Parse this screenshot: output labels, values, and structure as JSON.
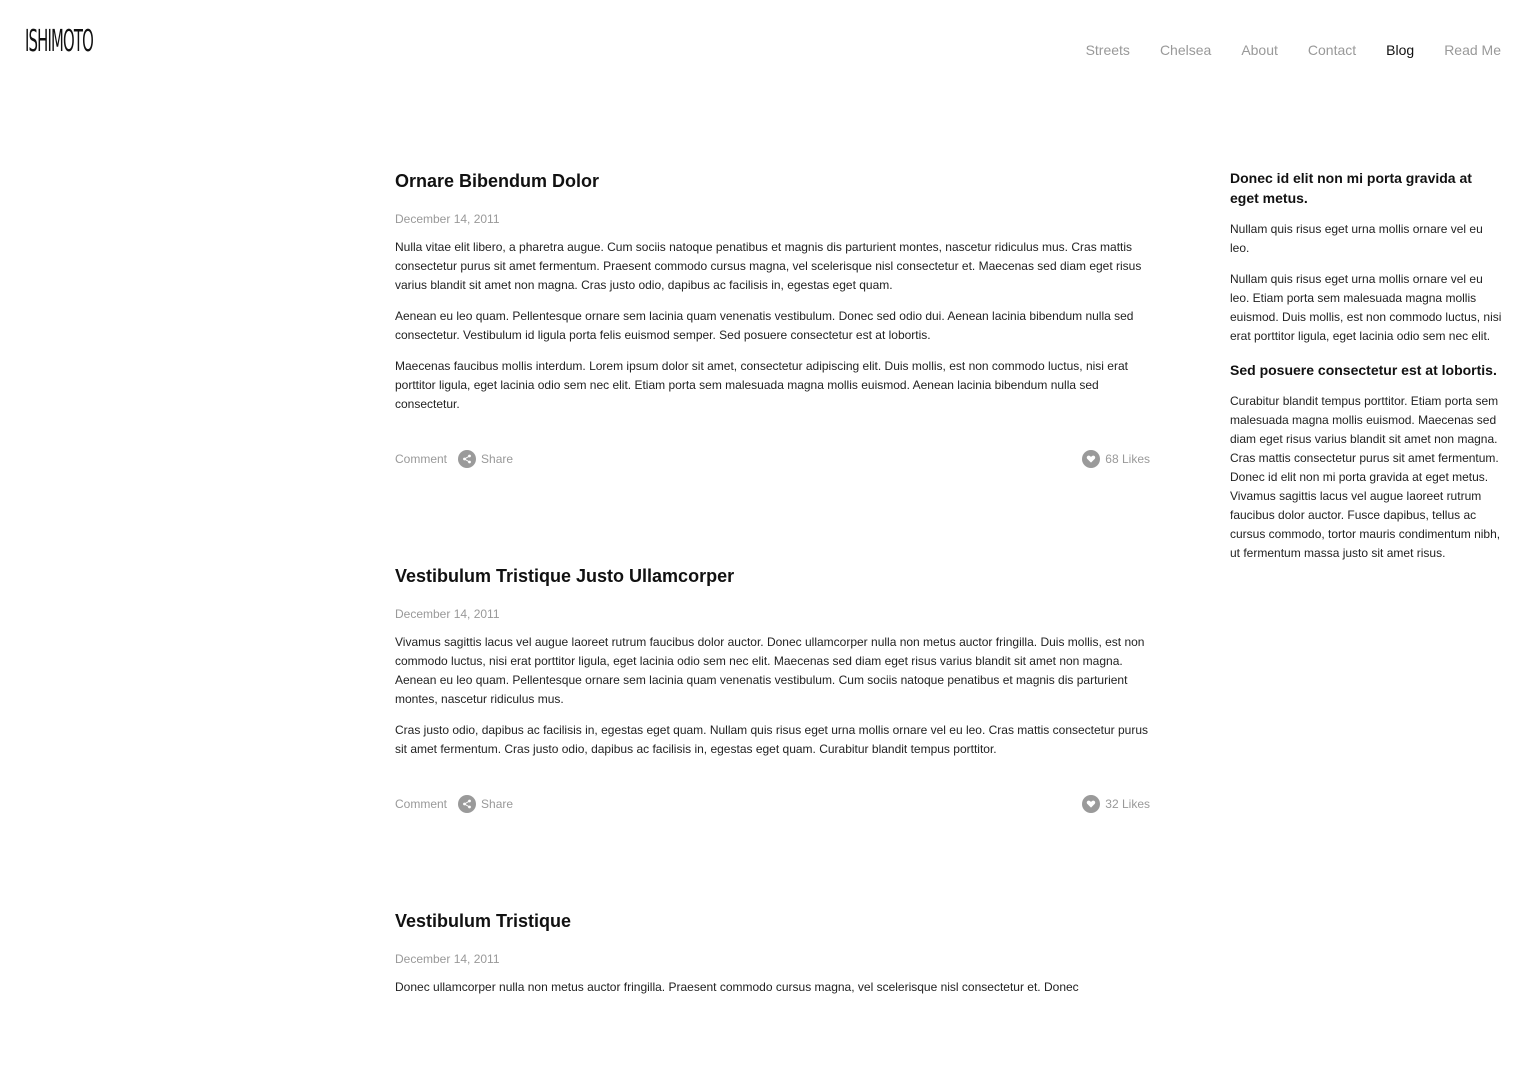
{
  "header": {
    "logo": "ISHIMOTO",
    "nav": [
      "Streets",
      "Chelsea",
      "About",
      "Contact",
      "Blog",
      "Read Me"
    ],
    "active_nav": "Blog"
  },
  "posts": [
    {
      "title": "Ornare Bibendum Dolor",
      "date": "December 14, 2011",
      "paragraphs": [
        "Nulla vitae elit libero, a pharetra augue. Cum sociis natoque penatibus et magnis dis parturient montes, nascetur ridiculus mus. Cras mattis consectetur purus sit amet fermentum. Praesent commodo cursus magna, vel scelerisque nisl consectetur et. Maecenas sed diam eget risus varius blandit sit amet non magna. Cras justo odio, dapibus ac facilisis in, egestas eget quam.",
        "Aenean eu leo quam. Pellentesque ornare sem lacinia quam venenatis vestibulum. Donec sed odio dui. Aenean lacinia bibendum nulla sed consectetur. Vestibulum id ligula porta felis euismod semper. Sed posuere consectetur est at lobortis.",
        "Maecenas faucibus mollis interdum. Lorem ipsum dolor sit amet, consectetur adipiscing elit. Duis mollis, est non commodo luctus, nisi erat porttitor ligula, eget lacinia odio sem nec elit. Etiam porta sem malesuada magna mollis euismod. Aenean lacinia bibendum nulla sed consectetur."
      ],
      "comment_label": "Comment",
      "share_label": "Share",
      "likes_label": "68 Likes"
    },
    {
      "title": "Vestibulum Tristique Justo Ullamcorper",
      "date": "December 14, 2011",
      "paragraphs": [
        "Vivamus sagittis lacus vel augue laoreet rutrum faucibus dolor auctor. Donec ullamcorper nulla non metus auctor fringilla. Duis mollis, est non commodo luctus, nisi erat porttitor ligula, eget lacinia odio sem nec elit. Maecenas sed diam eget risus varius blandit sit amet non magna. Aenean eu leo quam. Pellentesque ornare sem lacinia quam venenatis vestibulum. Cum sociis natoque penatibus et magnis dis parturient montes, nascetur ridiculus mus.",
        "Cras justo odio, dapibus ac facilisis in, egestas eget quam. Nullam quis risus eget urna mollis ornare vel eu leo. Cras mattis consectetur purus sit amet fermentum. Cras justo odio, dapibus ac facilisis in, egestas eget quam. Curabitur blandit tempus porttitor."
      ],
      "comment_label": "Comment",
      "share_label": "Share",
      "likes_label": "32 Likes"
    },
    {
      "title": "Vestibulum Tristique",
      "date": "December 14, 2011",
      "paragraphs": [
        "Donec ullamcorper nulla non metus auctor fringilla. Praesent commodo cursus magna, vel scelerisque nisl consectetur et. Donec"
      ]
    }
  ],
  "sidebar": {
    "widgets": [
      {
        "heading": "Donec id elit non mi porta gravida at eget metus.",
        "paragraphs": [
          "Nullam quis risus eget urna mollis ornare vel eu leo.",
          "Nullam quis risus eget urna mollis ornare vel eu leo. Etiam porta sem malesuada magna mollis euismod. Duis mollis, est non commodo luctus, nisi erat porttitor ligula, eget lacinia odio sem nec elit."
        ]
      },
      {
        "heading": "Sed posuere consectetur est at lobortis.",
        "paragraphs": [
          "Curabitur blandit tempus porttitor. Etiam porta sem malesuada magna mollis euismod. Maecenas sed diam eget risus varius blandit sit amet non magna. Cras mattis consectetur purus sit amet fermentum. Donec id elit non mi porta gravida at eget metus. Vivamus sagittis lacus vel augue laoreet rutrum faucibus dolor auctor. Fusce dapibus, tellus ac cursus commodo, tortor mauris condimentum nibh, ut fermentum massa justo sit amet risus."
        ]
      }
    ]
  },
  "icons": {
    "share": "share-icon",
    "like": "heart-icon"
  },
  "colors": {
    "text": "#222222",
    "muted": "#999999",
    "icon": "#9a9a9a",
    "active_nav": "#111111"
  }
}
